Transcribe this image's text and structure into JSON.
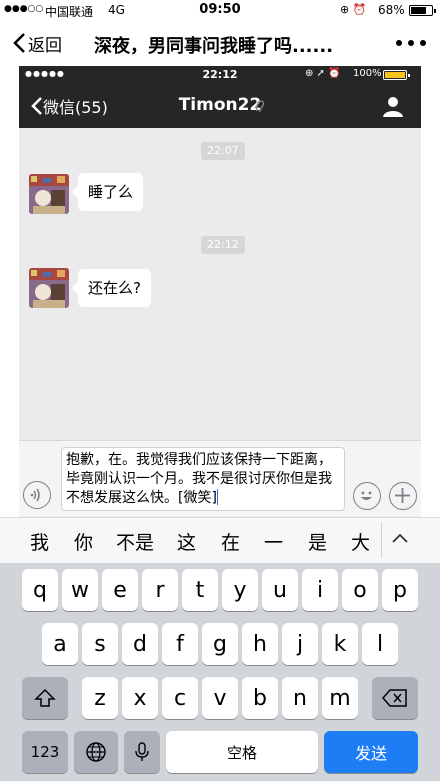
{
  "outer_status": {
    "signal": "●●●○○",
    "carrier": "中国联通",
    "network": "4G",
    "time": "09:50",
    "battery": "68%",
    "battery_level": 0.68
  },
  "outer_nav": {
    "back_label": "返回",
    "title": "深夜，男同事问我睡了吗......"
  },
  "inner_status": {
    "signal": "●●●●●",
    "time": "22:12",
    "battery": "100%",
    "battery_color": "#f7c21b"
  },
  "inner_nav": {
    "back_label": "微信(55)",
    "title": "Timon22"
  },
  "chat": {
    "messages": [
      {
        "time": "22:07",
        "text": "睡了么"
      },
      {
        "time": "22:12",
        "text": "还在么?"
      }
    ]
  },
  "input": {
    "text": "抱歉，在。我觉得我们应该保持一下距离，毕竟刚认识一个月。我不是很讨厌你但是我不想发展这么快。[微笑]"
  },
  "candidates": [
    "我",
    "你",
    "不是",
    "这",
    "在",
    "一",
    "是",
    "大"
  ],
  "keyboard": {
    "row1": [
      "q",
      "w",
      "e",
      "r",
      "t",
      "y",
      "u",
      "i",
      "o",
      "p"
    ],
    "row2": [
      "a",
      "s",
      "d",
      "f",
      "g",
      "h",
      "j",
      "k",
      "l"
    ],
    "row3": [
      "z",
      "x",
      "c",
      "v",
      "b",
      "n",
      "m"
    ],
    "num_label": "123",
    "space_label": "空格",
    "send_label": "发送"
  },
  "colors": {
    "inner_nav_bg": "#262626",
    "chat_bg": "#ebebeb",
    "send_key": "#1e7cf5"
  }
}
